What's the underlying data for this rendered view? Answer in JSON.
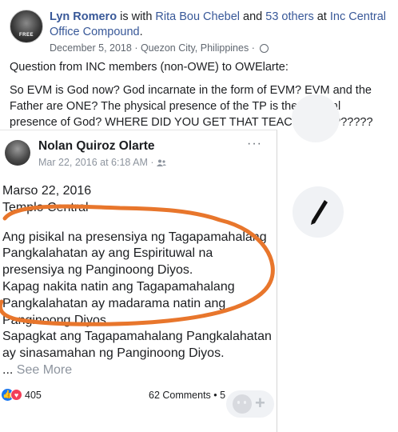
{
  "post": {
    "author": "Lyn Romero",
    "with_text": " is with ",
    "tagged": "Rita Bou Chebel",
    "and_text": " and ",
    "others": "53 others",
    "at_text": " at ",
    "place": "Inc Central Office Compound",
    "period": ".",
    "avatar_text": "FREE",
    "date": "December 5, 2018",
    "sep": " · ",
    "location": "Quezon City, Philippines",
    "sep2": " · ",
    "privacy_icon": "globe-icon",
    "paragraphs": [
      "Question from INC members (non-OWE) to OWElarte:",
      "So EVM is God now? God incarnate in the form of EVM? EVM and the Father are ONE? The physical presence of the TP is the spiritual presence of God? WHERE DID YOU GET THAT TEACHING????????"
    ]
  },
  "shared_screenshot": {
    "author": "Nolan Quiroz Olarte",
    "date": "Mar 22, 2016 at 6:18 AM · ",
    "audience_icon": "friends-icon",
    "menu": "···",
    "lines": [
      "Marso 22, 2016",
      "Templo Central",
      "Ang pisikal na presensiya ng Tagapamahalang",
      "Pangkalahatan ay ang Espirituwal na",
      "presensiya ng Panginoong Diyos.",
      "Kapag nakita natin ang Tagapamahalang",
      "Pangkalahatan ay madarama natin ang",
      "Panginoong Diyos.",
      "Sapagkat ang Tagapamahalang Pangkalahatan",
      "ay sinasamahan ng Panginoong Diyos."
    ],
    "see_more_prefix": "... ",
    "see_more": "See More",
    "reactions_count": "405",
    "comments": "62 Comments • 5",
    "annotation_color": "#e8762c"
  },
  "controls": {
    "pen_icon": "pen-icon",
    "emoji_icon": "emoji-add-icon",
    "emoji_plus": "+"
  }
}
